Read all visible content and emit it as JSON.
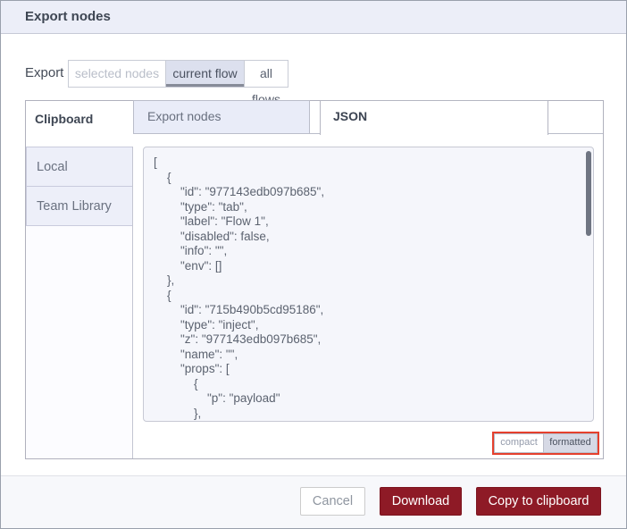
{
  "dialog": {
    "title": "Export nodes"
  },
  "export_row": {
    "label": "Export",
    "options": [
      {
        "label": "selected nodes",
        "state": "disabled"
      },
      {
        "label": "current flow",
        "state": "selected"
      },
      {
        "label": "all flows",
        "state": "normal"
      }
    ]
  },
  "library": {
    "active_section": "Clipboard",
    "tabs": [
      {
        "label": "Export nodes",
        "state": "inactive"
      },
      {
        "label": "JSON",
        "state": "active"
      }
    ],
    "sidebar_items": [
      {
        "label": "Local"
      },
      {
        "label": "Team Library"
      }
    ]
  },
  "editor": {
    "code": "[\n    {\n        \"id\": \"977143edb097b685\",\n        \"type\": \"tab\",\n        \"label\": \"Flow 1\",\n        \"disabled\": false,\n        \"info\": \"\",\n        \"env\": []\n    },\n    {\n        \"id\": \"715b490b5cd95186\",\n        \"type\": \"inject\",\n        \"z\": \"977143edb097b685\",\n        \"name\": \"\",\n        \"props\": [\n            {\n                \"p\": \"payload\"\n            },",
    "format_toggle": {
      "compact_label": "compact",
      "formatted_label": "formatted",
      "selected": "formatted"
    }
  },
  "footer": {
    "cancel_label": "Cancel",
    "download_label": "Download",
    "copy_label": "Copy to clipboard"
  },
  "colors": {
    "primary_button": "#8e1a26",
    "annotation_highlight": "#e5402d",
    "header_background": "#eceef8",
    "selected_lavender": "#dce0ee",
    "panel_lavender": "#edeff9",
    "code_background": "#f5f6fb"
  }
}
